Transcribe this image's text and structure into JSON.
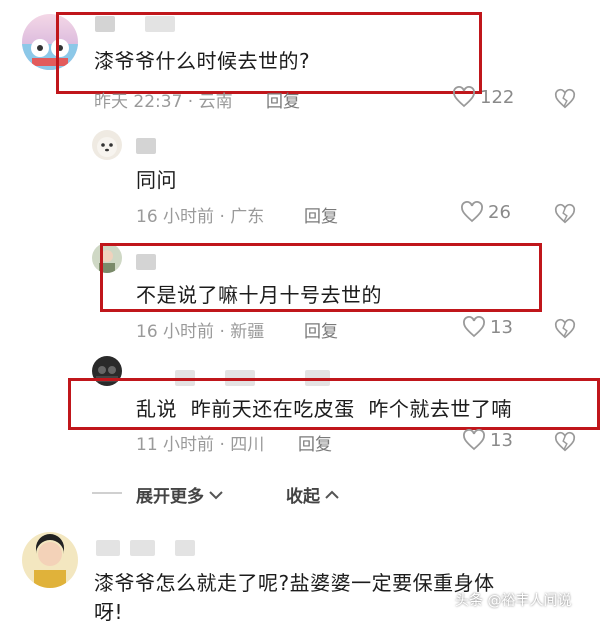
{
  "comments": [
    {
      "text": "漆爷爷什么时候去世的?",
      "meta": "昨天 22:37 · 云南",
      "reply": "回复",
      "likes": "122"
    },
    {
      "text": "同问",
      "meta": "16 小时前 · 广东",
      "reply": "回复",
      "likes": "26"
    },
    {
      "text": "不是说了嘛十月十号去世的",
      "meta": "16 小时前 · 新疆",
      "reply": "回复",
      "likes": "13"
    },
    {
      "text": "乱说  昨前天还在吃皮蛋  咋个就去世了喃",
      "meta": "11 小时前 · 四川",
      "reply": "回复",
      "likes": "13"
    },
    {
      "text_line1": "漆爷爷怎么就走了呢?盐婆婆一定要保重身体",
      "text_line2": "呀!"
    }
  ],
  "expand": {
    "more": "展开更多",
    "collapse": "收起"
  },
  "watermark": "头条 @裕丰人间说",
  "colors": {
    "highlight_box": "#c0161b"
  }
}
